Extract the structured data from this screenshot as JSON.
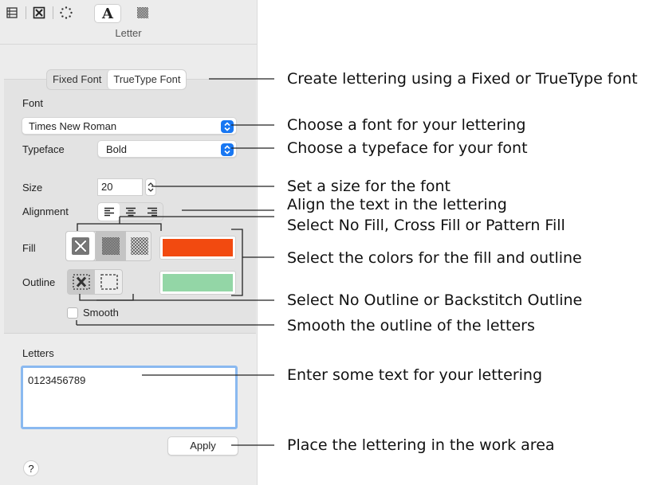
{
  "panel": {
    "title": "Letter",
    "toolbar_icons": [
      "list-icon",
      "cross-box-icon",
      "dots-circle-icon",
      "letter-a-icon",
      "pattern-icon"
    ],
    "toolbar_letter": "A",
    "font_tabs": {
      "fixed": "Fixed Font",
      "truetype": "TrueType Font",
      "selected": "TrueType Font"
    },
    "font_label": "Font",
    "font_value": "Times New Roman",
    "typeface_label": "Typeface",
    "typeface_value": "Bold",
    "size_label": "Size",
    "size_value": "20",
    "alignment_label": "Alignment",
    "alignment_selected": "left",
    "fill_label": "Fill",
    "outline_label": "Outline",
    "fill_color": "#f24a10",
    "outline_color": "#93d6a6",
    "smooth_label": "Smooth",
    "smooth_checked": false,
    "letters_label": "Letters",
    "letters_value": "0123456789",
    "apply_label": "Apply",
    "help_label": "?"
  },
  "callouts": [
    "Create lettering using a Fixed or TrueType font",
    "Choose a font for your lettering",
    "Choose a typeface for your font",
    "Set a size for the font",
    "Align the text in the lettering",
    "Select No Fill, Cross Fill or Pattern Fill",
    "Select the colors for the fill and outline",
    "Select No Outline or Backstitch Outline",
    "Smooth the outline of the letters",
    "Enter some text for your lettering",
    "Place the lettering in the work area"
  ]
}
